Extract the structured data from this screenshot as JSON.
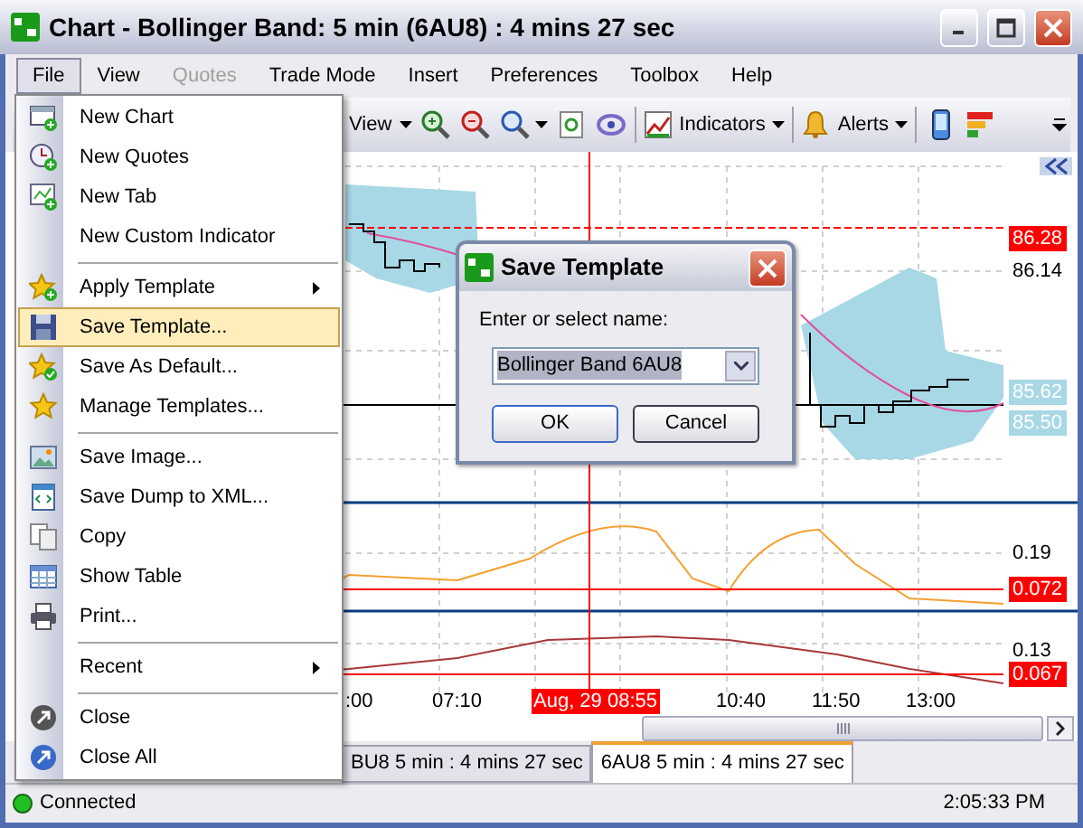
{
  "window": {
    "title": "Chart - Bollinger Band: 5 min (6AU8) : 4 mins 27 sec"
  },
  "menu_bar": [
    {
      "label": "File",
      "selected": true,
      "disabled": false
    },
    {
      "label": "View",
      "selected": false,
      "disabled": false
    },
    {
      "label": "Quotes",
      "selected": false,
      "disabled": true
    },
    {
      "label": "Trade Mode",
      "selected": false,
      "disabled": false
    },
    {
      "label": "Insert",
      "selected": false,
      "disabled": false
    },
    {
      "label": "Preferences",
      "selected": false,
      "disabled": false
    },
    {
      "label": "Toolbox",
      "selected": false,
      "disabled": false
    },
    {
      "label": "Help",
      "selected": false,
      "disabled": false
    }
  ],
  "toolbar": {
    "view": "View",
    "indicators": "Indicators",
    "alerts": "Alerts"
  },
  "file_menu": [
    [
      {
        "label": "New Chart",
        "submenu": false,
        "selected": false
      },
      {
        "label": "New Quotes",
        "submenu": false,
        "selected": false
      },
      {
        "label": "New Tab",
        "submenu": false,
        "selected": false
      },
      {
        "label": "New Custom Indicator",
        "submenu": false,
        "selected": false
      }
    ],
    [
      {
        "label": "Apply Template",
        "submenu": true,
        "selected": false
      },
      {
        "label": "Save Template...",
        "submenu": false,
        "selected": true
      },
      {
        "label": "Save As Default...",
        "submenu": false,
        "selected": false
      },
      {
        "label": "Manage Templates...",
        "submenu": false,
        "selected": false
      }
    ],
    [
      {
        "label": "Save Image...",
        "submenu": false,
        "selected": false
      },
      {
        "label": "Save Dump to XML...",
        "submenu": false,
        "selected": false
      },
      {
        "label": "Copy",
        "submenu": false,
        "selected": false
      },
      {
        "label": "Show Table",
        "submenu": false,
        "selected": false
      },
      {
        "label": "Print...",
        "submenu": false,
        "selected": false
      }
    ],
    [
      {
        "label": "Recent",
        "submenu": true,
        "selected": false
      }
    ],
    [
      {
        "label": "Close",
        "submenu": false,
        "selected": false
      },
      {
        "label": "Close All",
        "submenu": false,
        "selected": false
      }
    ]
  ],
  "dialog": {
    "title": "Save Template",
    "prompt": "Enter or select name:",
    "value": "Bollinger Band 6AU8",
    "buttons": [
      "OK",
      "Cancel"
    ]
  },
  "chart": {
    "axis_labels": [
      {
        "text": "86.28",
        "kind": "marker"
      },
      {
        "text": "86.14",
        "kind": "plain"
      },
      {
        "text": "85.62",
        "kind": "band"
      },
      {
        "text": "85.50",
        "kind": "band"
      },
      {
        "text": "0.19",
        "kind": "plain"
      },
      {
        "text": "0.072",
        "kind": "marker"
      },
      {
        "text": "0.13",
        "kind": "plain"
      },
      {
        "text": "0.067",
        "kind": "marker"
      }
    ],
    "time_labels": [
      ":00",
      "07:10",
      "10:40",
      "11:50",
      "13:00"
    ],
    "cursor_time": "Aug, 29 08:55"
  },
  "tabs": [
    {
      "label": "BU8 5 min : 4 mins 27 sec",
      "selected": false
    },
    {
      "label": "6AU8 5 min : 4 mins 27 sec",
      "selected": true
    }
  ],
  "status_bar": {
    "connection": "Connected",
    "connected": true,
    "time": "2:05:33 PM"
  }
}
